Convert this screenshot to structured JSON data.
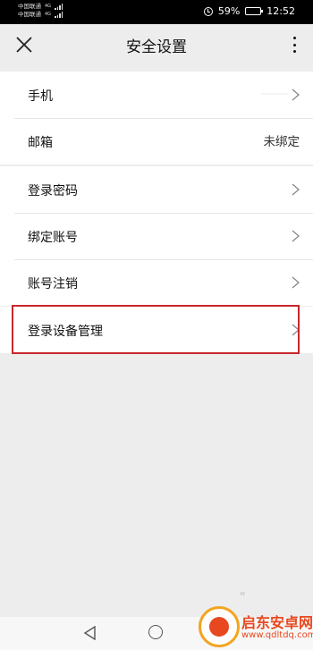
{
  "status_bar": {
    "carrier_1": "中国联通",
    "carrier_1_net": "4G",
    "carrier_2": "中国联通",
    "carrier_2_net": "4G",
    "battery_level": "59%",
    "battery_fraction": 0.59,
    "time": "12:52"
  },
  "header": {
    "title": "安全设置",
    "back_icon": "close-x-icon",
    "menu_icon": "more-vertical-icon"
  },
  "group_1": {
    "rows": [
      {
        "label": "手机",
        "value": ""
      },
      {
        "label": "邮箱",
        "value": "未绑定"
      }
    ]
  },
  "group_2": {
    "rows": [
      {
        "label": "登录密码"
      },
      {
        "label": "绑定账号"
      },
      {
        "label": "账号注销"
      }
    ]
  },
  "group_3": {
    "rows": [
      {
        "label": "登录设备管理",
        "highlighted": true
      }
    ]
  },
  "colors": {
    "highlight_border": "#c8272d",
    "background": "#ededed"
  },
  "watermark": {
    "name": "启东安卓网",
    "url": "www.qdltdq.com"
  }
}
